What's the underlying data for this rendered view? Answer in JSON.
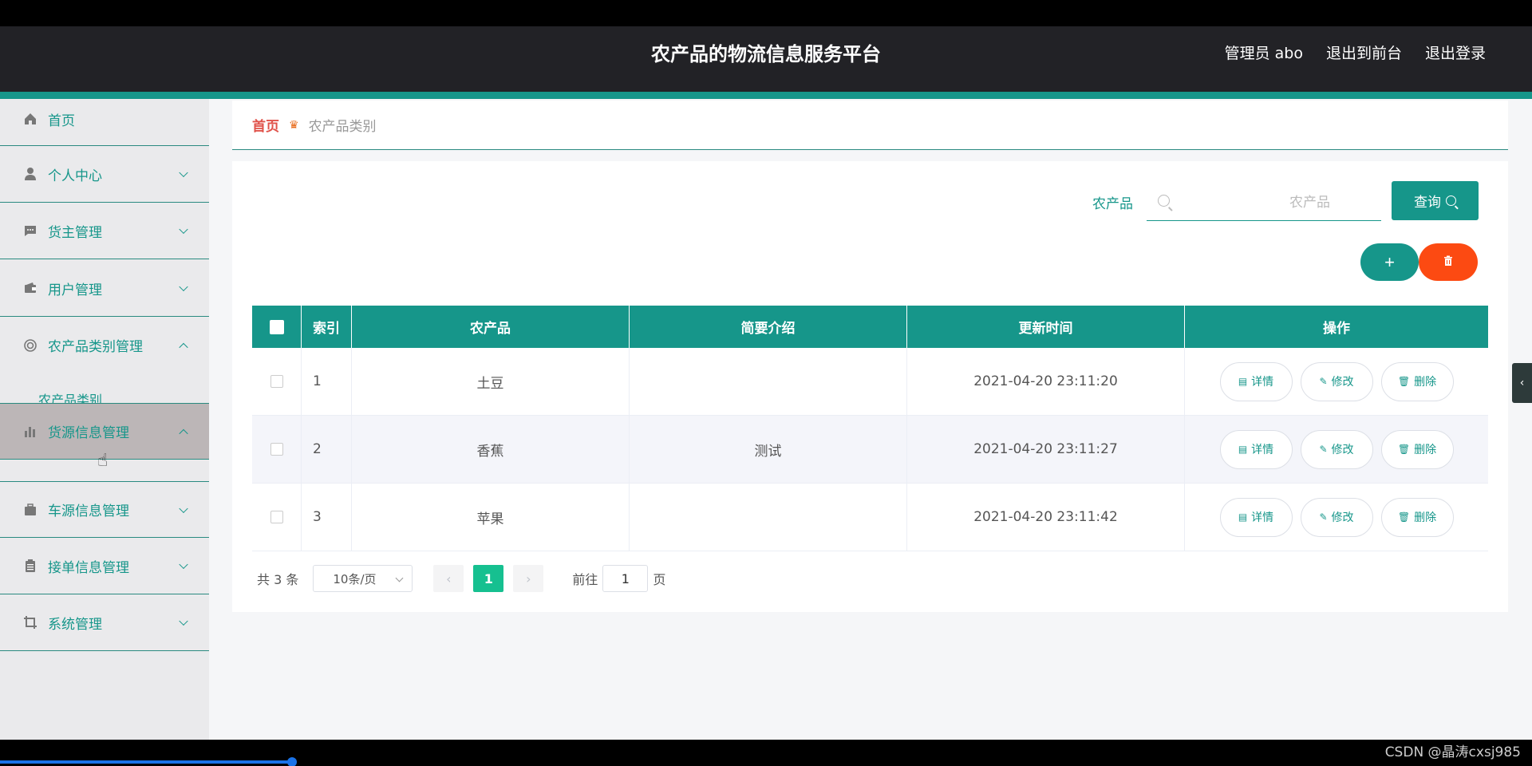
{
  "header": {
    "title": "农产品的物流信息服务平台",
    "admin": "管理员 abo",
    "to_frontend": "退出到前台",
    "logout": "退出登录"
  },
  "sidebar": {
    "items": [
      {
        "label": "首页",
        "icon": "home-icon"
      },
      {
        "label": "个人中心",
        "icon": "user-icon"
      },
      {
        "label": "货主管理",
        "icon": "chat-icon"
      },
      {
        "label": "用户管理",
        "icon": "wallet-icon"
      },
      {
        "label": "农产品类别管理",
        "icon": "lifebuoy-icon"
      },
      {
        "label": "货源信息管理",
        "icon": "bar-chart-icon"
      },
      {
        "label": "车源信息管理",
        "icon": "briefcase-icon"
      },
      {
        "label": "接单信息管理",
        "icon": "clipboard-icon"
      },
      {
        "label": "系统管理",
        "icon": "crop-icon"
      }
    ],
    "sub_item": "农产品类别"
  },
  "breadcrumb": {
    "home": "首页",
    "current": "农产品类别"
  },
  "search": {
    "label": "农产品",
    "placeholder": "农产品",
    "button": "查询"
  },
  "table": {
    "headers": [
      "索引",
      "农产品",
      "简要介绍",
      "更新时间",
      "操作"
    ],
    "rows": [
      {
        "index": "1",
        "product": "土豆",
        "intro": "",
        "time": "2021-04-20 23:11:20"
      },
      {
        "index": "2",
        "product": "香蕉",
        "intro": "测试",
        "time": "2021-04-20 23:11:27"
      },
      {
        "index": "3",
        "product": "苹果",
        "intro": "",
        "time": "2021-04-20 23:11:42"
      }
    ],
    "actions": {
      "detail": "详情",
      "edit": "修改",
      "delete": "删除"
    }
  },
  "pagination": {
    "total": "共 3 条",
    "page_size": "10条/页",
    "current": "1",
    "goto": "前往",
    "goto_value": "1",
    "page_suffix": "页"
  },
  "watermark": "CSDN @晶涛cxsj985",
  "colors": {
    "primary": "#16968a",
    "danger": "#fc4a12",
    "header_bg": "#222226"
  }
}
